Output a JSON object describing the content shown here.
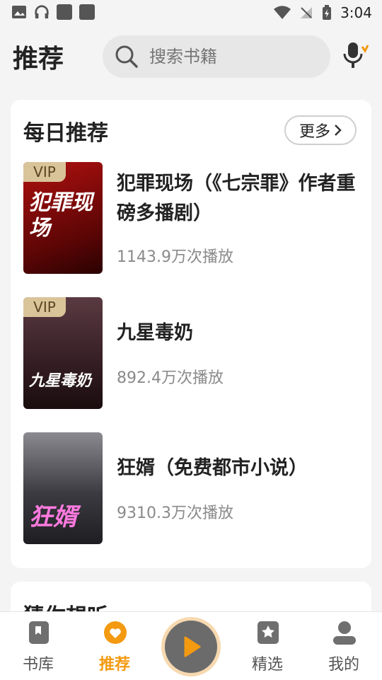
{
  "status_bar": {
    "time": "3:04"
  },
  "header": {
    "title": "推荐",
    "search_placeholder": "搜索书籍"
  },
  "daily": {
    "title": "每日推荐",
    "more_label": "更多",
    "books": [
      {
        "title": "犯罪现场（《七宗罪》作者重磅多播剧）",
        "plays": "1143.9万次播放",
        "vip": "VIP",
        "cover_text": "犯罪现场"
      },
      {
        "title": "九星毒奶",
        "plays": "892.4万次播放",
        "vip": "VIP",
        "cover_text": "九星毒奶"
      },
      {
        "title": "狂婿（免费都市小说）",
        "plays": "9310.3万次播放",
        "vip": "",
        "cover_text": "狂婿"
      }
    ]
  },
  "guess": {
    "title": "猜你想听"
  },
  "nav": {
    "items": [
      {
        "label": "书库"
      },
      {
        "label": "推荐"
      },
      {
        "label": "精选"
      },
      {
        "label": "我的"
      }
    ]
  },
  "colors": {
    "accent": "#f39a11",
    "background": "#f4f4f4"
  }
}
